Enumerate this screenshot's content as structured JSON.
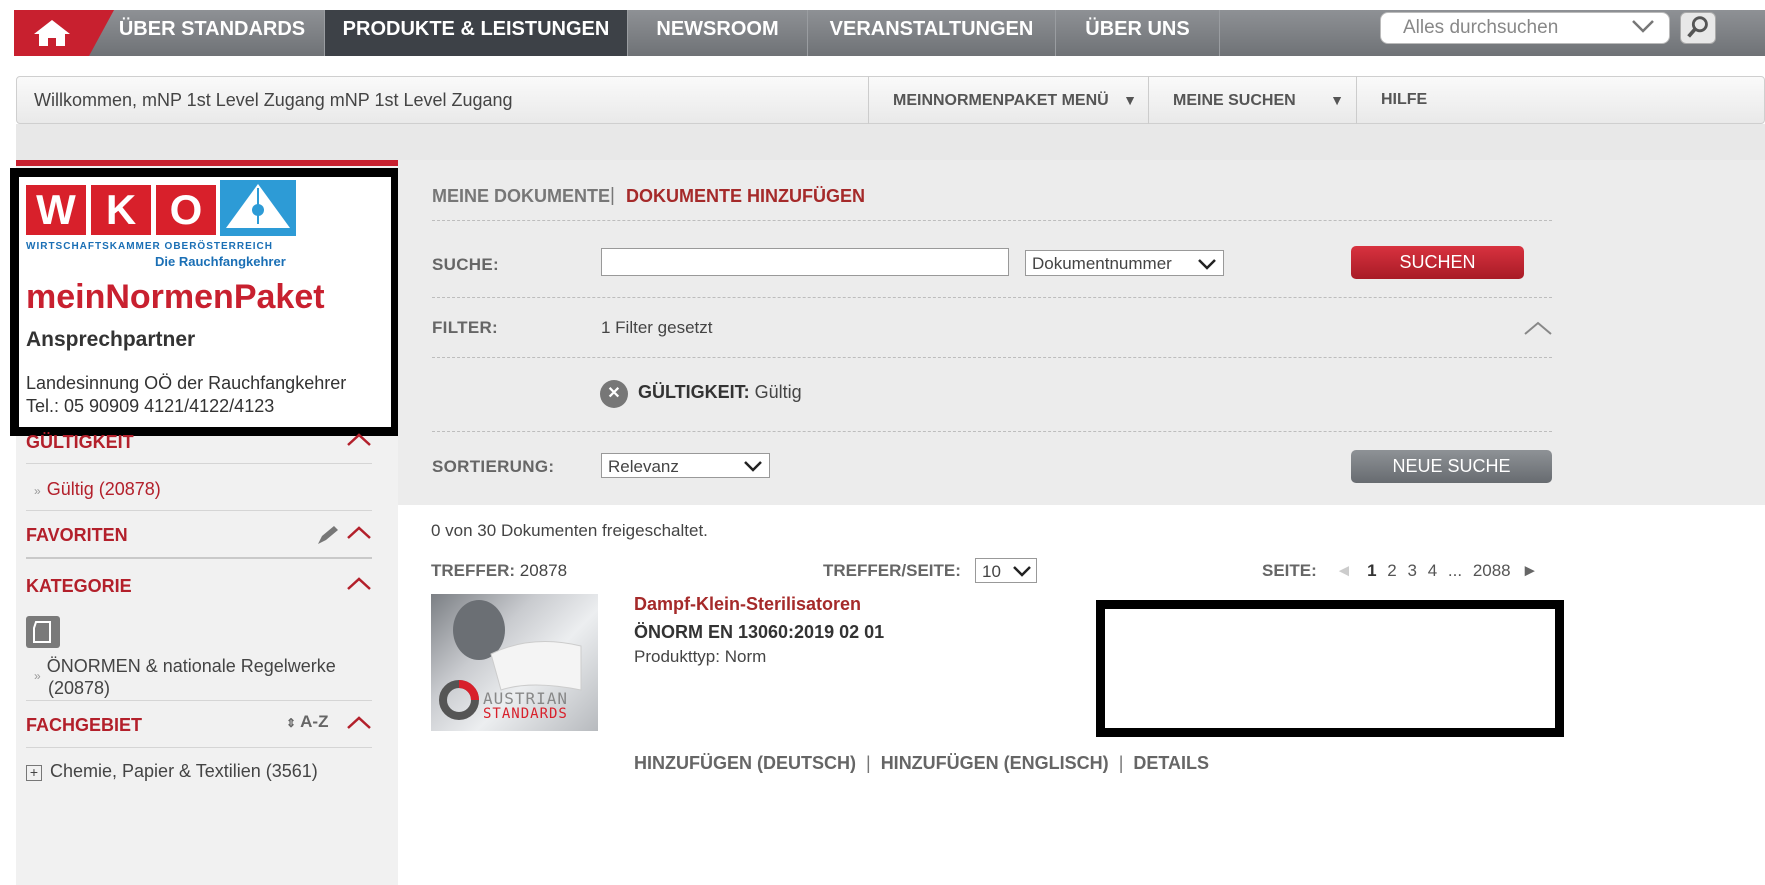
{
  "nav": {
    "items": [
      "ÜBER STANDARDS",
      "PRODUKTE & LEISTUNGEN",
      "NEWSROOM",
      "VERANSTALTUNGEN",
      "ÜBER UNS"
    ],
    "search_placeholder": "Alles durchsuchen"
  },
  "welcome": {
    "text": "Willkommen, mNP 1st Level Zugang mNP 1st Level Zugang",
    "menu1": "MEINNORMENPAKET MENÜ",
    "menu2": "MEINE SUCHEN",
    "menu3": "HILFE"
  },
  "sidebar": {
    "wko_letters": [
      "W",
      "K",
      "O"
    ],
    "wko_sub1": "WIRTSCHAFTSKAMMER OBERÖSTERREICH",
    "wko_sub2": "Die Rauchfangkehrer",
    "brand": "meinNormenPaket",
    "contact_title": "Ansprechpartner",
    "contact_line1": "Landesinnung OÖ der Rauchfangkehrer",
    "contact_line2": "Tel.: 05 90909 4121/4122/4123",
    "gueltigkeit_head": "GÜLTIGKEIT",
    "gueltig_link": "Gültig (20878)",
    "favoriten_head": "FAVORITEN",
    "kategorie_head": "KATEGORIE",
    "kategorie_item1": "ÖNORMEN & nationale Regelwerke",
    "kategorie_item2": "(20878)",
    "fachgebiet_head": "FACHGEBIET",
    "fachgebiet_sort": "A-Z",
    "fachgebiet_item": "Chemie, Papier & Textilien (3561)"
  },
  "main": {
    "tab_meine": "MEINE DOKUMENTE",
    "tab_sep": "|",
    "tab_hinzu": "DOKUMENTE HINZUFÜGEN",
    "suche_label": "SUCHE:",
    "suche_select": "Dokumentnummer",
    "suche_button": "SUCHEN",
    "filter_label": "FILTER:",
    "filter_text": "1 Filter gesetzt",
    "filter_tag_label": "GÜLTIGKEIT:",
    "filter_tag_value": "Gültig",
    "sort_label": "SORTIERUNG:",
    "sort_value": "Relevanz",
    "neue_suche": "NEUE SUCHE",
    "freigeschaltet": "0 von 30 Dokumenten freigeschaltet.",
    "treffer_label": "TREFFER:",
    "treffer_value": "20878",
    "per_page_label": "TREFFER/SEITE:",
    "per_page_value": "10",
    "seite_label": "SEITE:",
    "pages": [
      "1",
      "2",
      "3",
      "4",
      "...",
      "2088"
    ],
    "thumb_text1": "AUSTRIAN",
    "thumb_text2": "STANDARDS",
    "doc_title": "Dampf-Klein-Sterilisatoren",
    "doc_number": "ÖNORM EN 13060:2019 02 01",
    "doc_type": "Produkttyp: Norm",
    "action1": "HINZUFÜGEN (DEUTSCH)",
    "action2": "HINZUFÜGEN (ENGLISCH)",
    "action3": "DETAILS"
  },
  "colors": {
    "brand_red": "#c8202f",
    "nav_gray": "#7f8286",
    "nav_active": "#3d4147",
    "link_red": "#a52a2a"
  },
  "icons": [
    "home-icon",
    "chevron-down-icon",
    "search-icon",
    "caret-up-icon",
    "pencil-icon",
    "document-icon",
    "sort-icon",
    "plus-box-icon",
    "close-circle-icon",
    "arrow-left-icon",
    "arrow-right-icon"
  ]
}
